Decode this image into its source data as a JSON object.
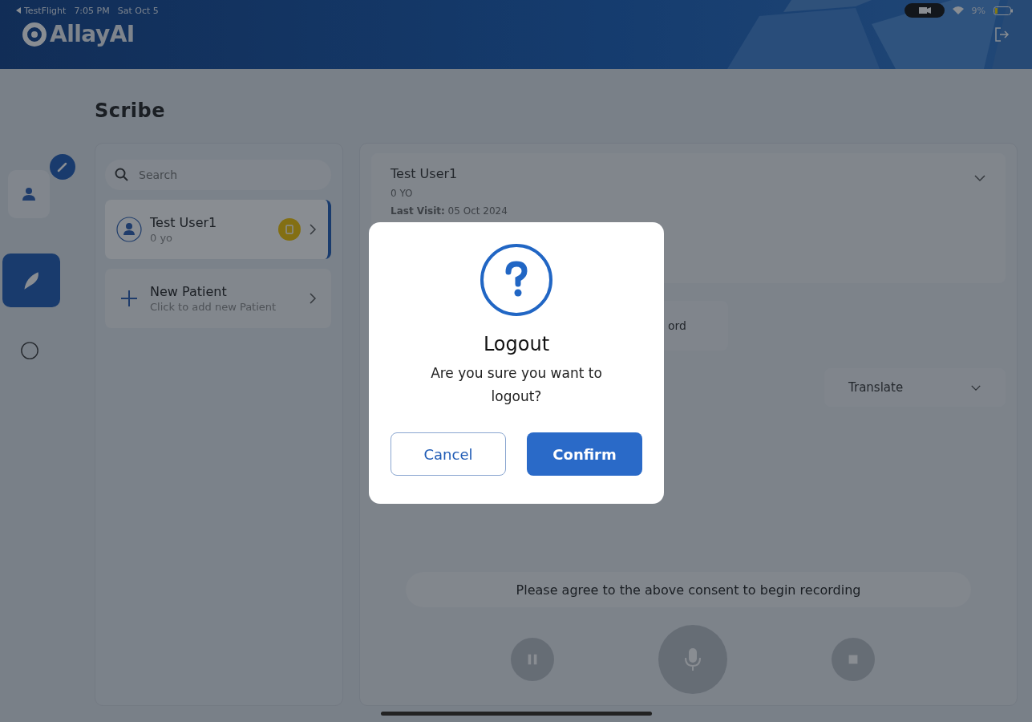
{
  "status_bar": {
    "app": "TestFlight",
    "time": "7:05 PM",
    "date": "Sat Oct 5",
    "battery": "9%"
  },
  "header": {
    "logo": "AllayAI"
  },
  "page": {
    "title": "Scribe"
  },
  "rail": [
    {
      "kind": "profile",
      "selected": false
    },
    {
      "kind": "scribe",
      "selected": true
    },
    {
      "kind": "chat",
      "selected": false
    }
  ],
  "search": {
    "placeholder": "Search"
  },
  "patients": [
    {
      "kind": "patient",
      "name": "Test User1",
      "subtitle": "0 yo",
      "selected": true
    },
    {
      "kind": "add",
      "name": "New Patient",
      "subtitle": "Click to add new Patient",
      "selected": false
    }
  ],
  "detail": {
    "name": "Test User1",
    "age": "0 YO",
    "last_visit": "**Last Visit:** 05 Oct 2024"
  },
  "record_button": {
    "label": "ord"
  },
  "translate": {
    "label": "Translate"
  },
  "consent_tip": "Please agree to the above consent to begin recording",
  "dialog": {
    "title": "Logout",
    "message": "Are you sure you want to logout?",
    "buttons": [
      {
        "kind": "secondary",
        "label": "Cancel"
      },
      {
        "kind": "primary",
        "label": "Confirm"
      }
    ]
  }
}
